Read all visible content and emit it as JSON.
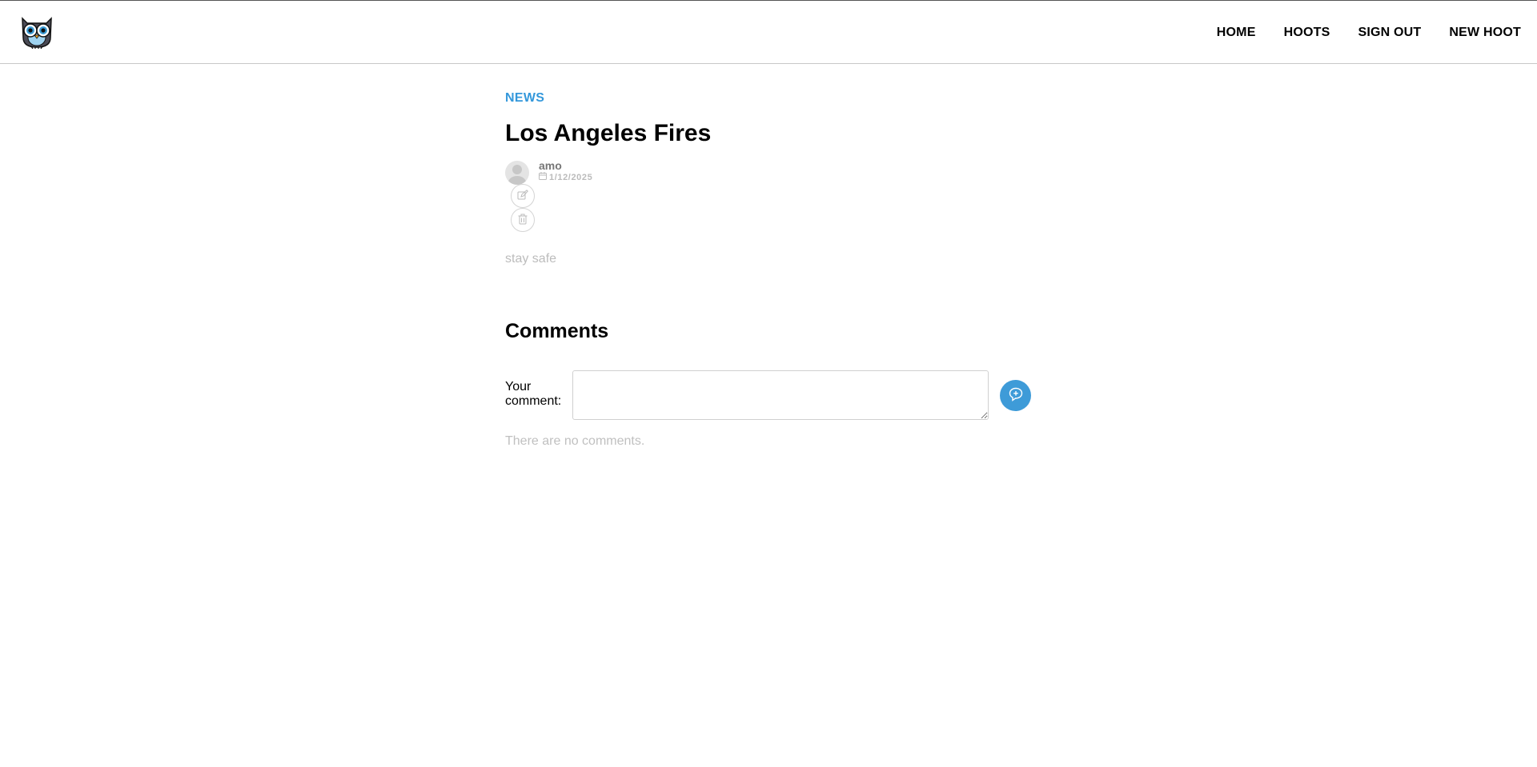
{
  "nav": {
    "logo_icon": "owl-logo-icon",
    "links": [
      "HOME",
      "HOOTS",
      "SIGN OUT",
      "NEW HOOT"
    ]
  },
  "post": {
    "category": "NEWS",
    "title": "Los Angeles Fires",
    "author": "amo",
    "date": "1/12/2025",
    "text": "stay safe"
  },
  "comments": {
    "heading": "Comments",
    "label": "Your comment:",
    "input_value": "",
    "empty_text": "There are no comments."
  },
  "colors": {
    "accent": "#3498db",
    "submit_button": "#3e9bd8",
    "muted_text": "#bcbcbc"
  }
}
